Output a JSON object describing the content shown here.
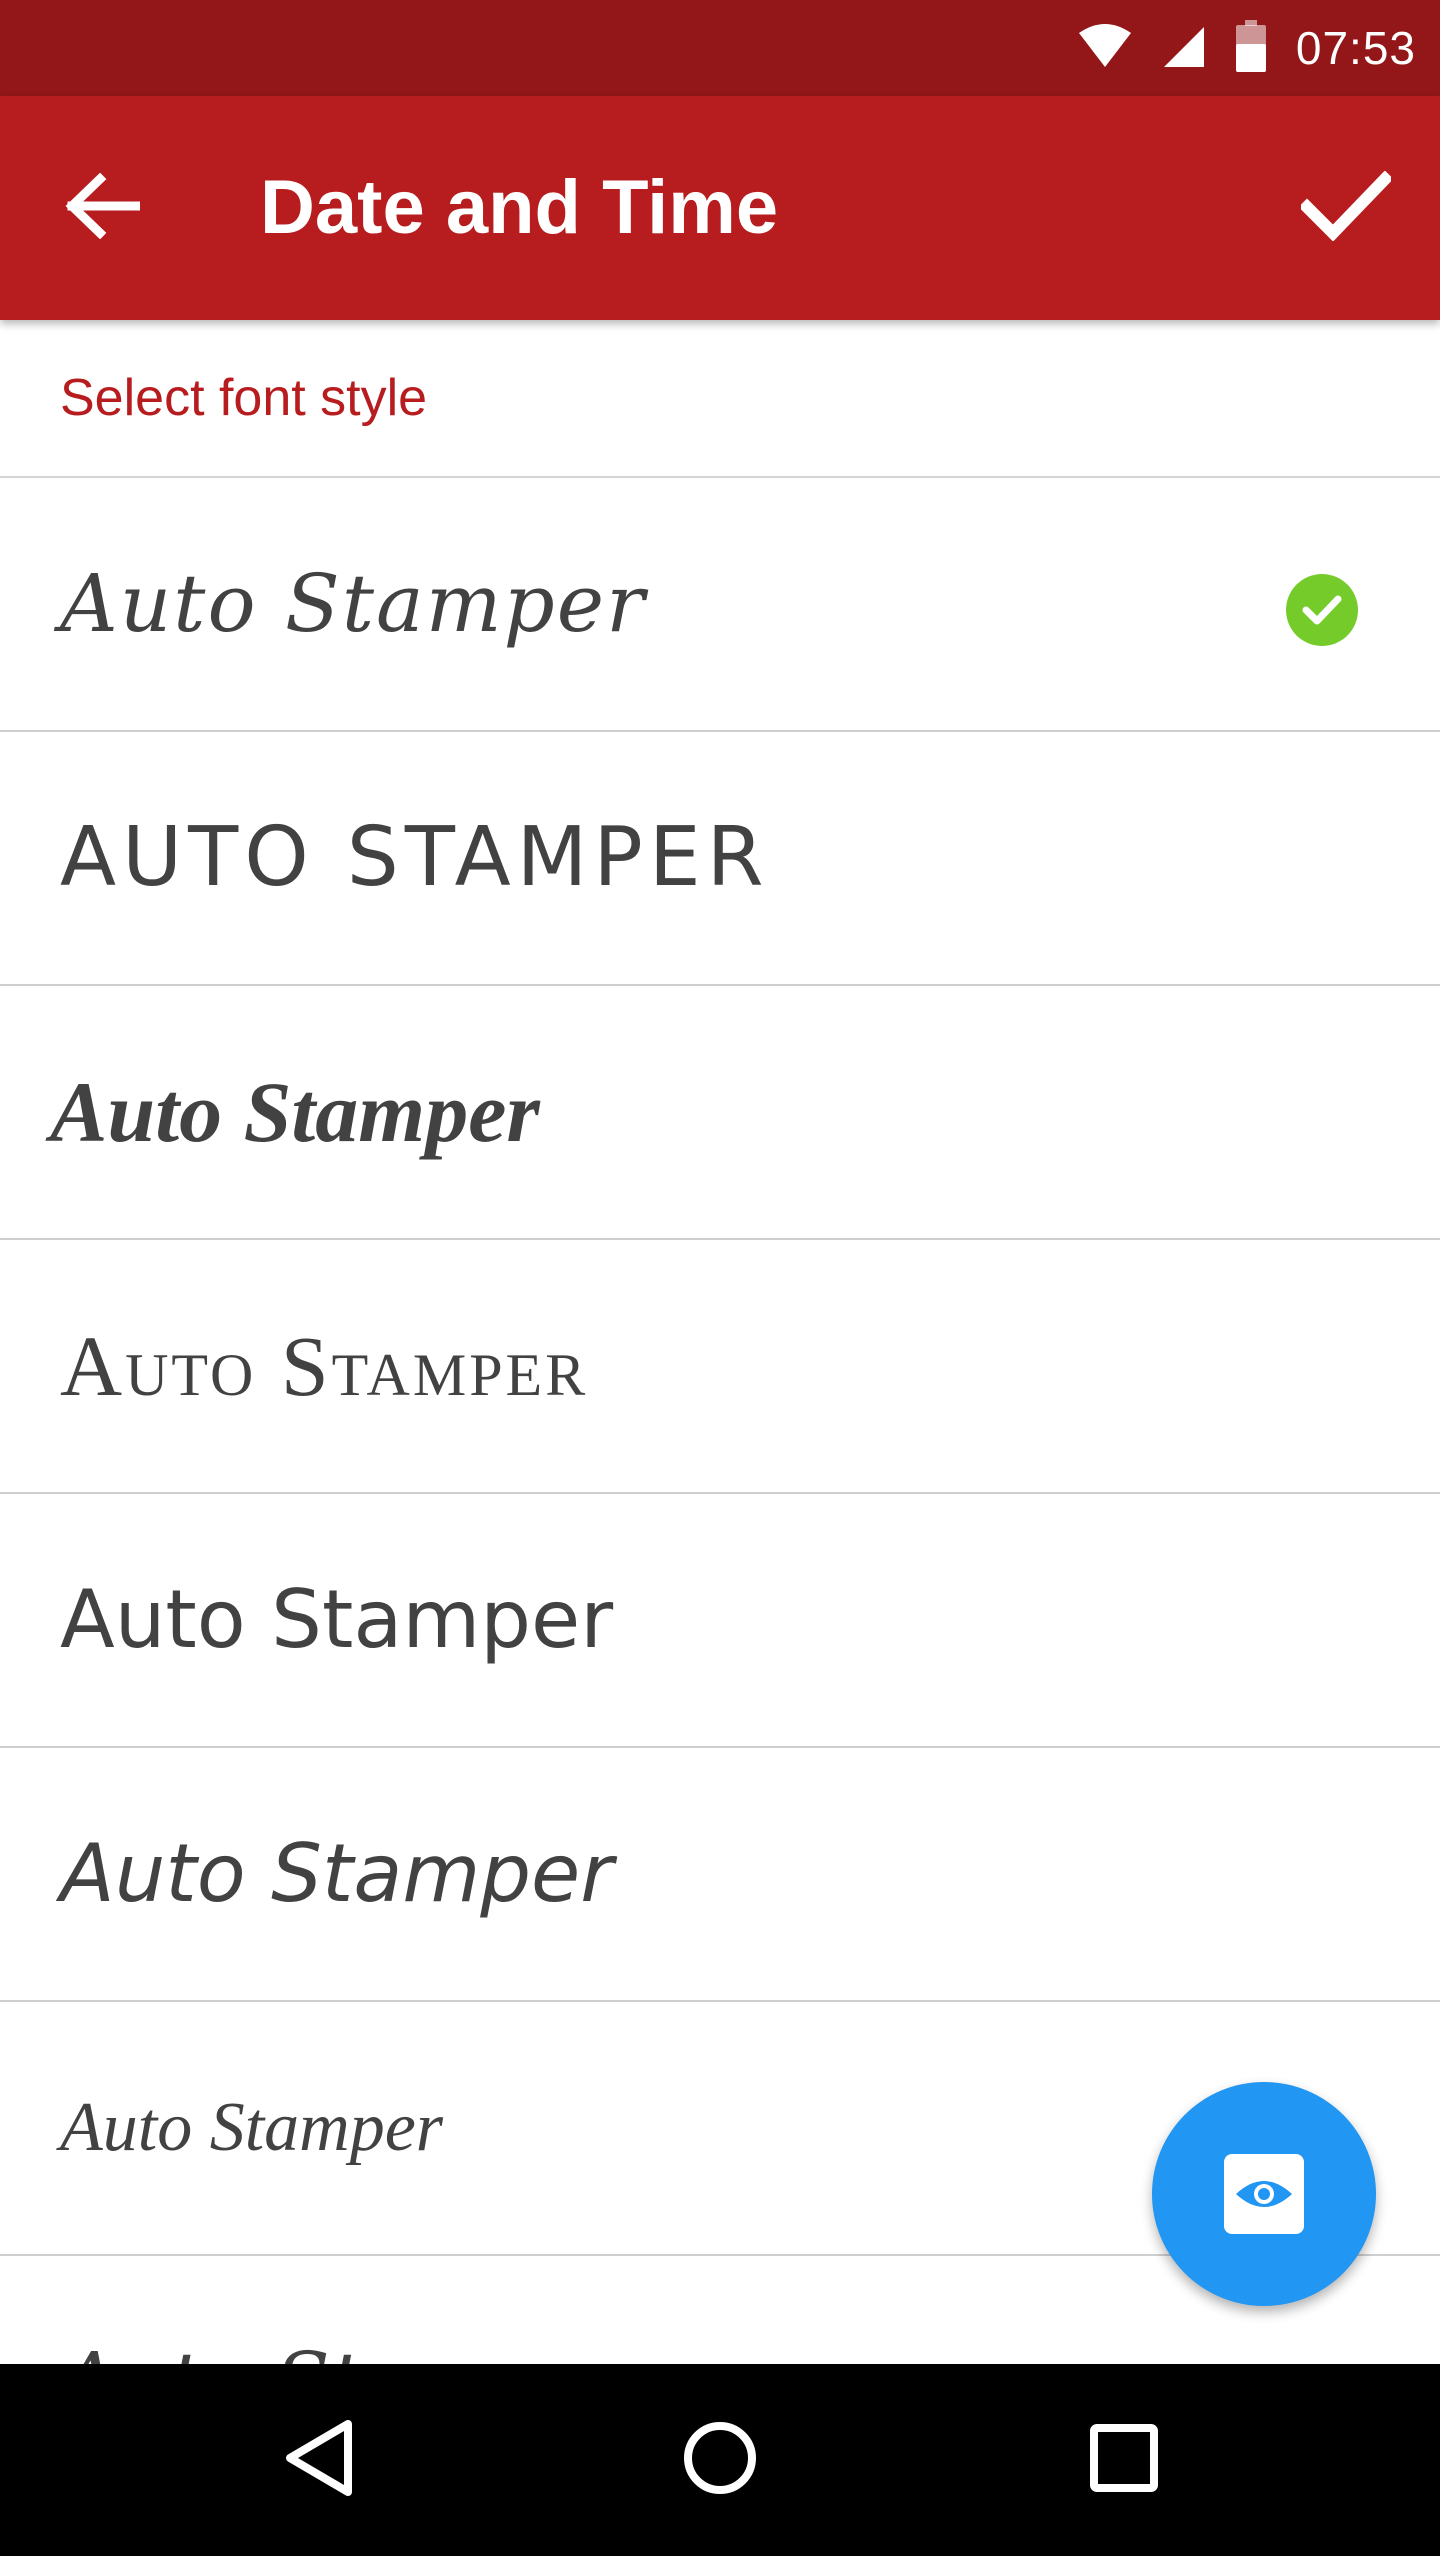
{
  "status_bar": {
    "time": "07:53",
    "icons": [
      "wifi-icon",
      "cell-signal-icon",
      "battery-icon"
    ]
  },
  "app_bar": {
    "title": "Date and Time",
    "back_icon": "arrow-left-icon",
    "confirm_icon": "check-icon",
    "background_color": "#b71c1f"
  },
  "section": {
    "label": "Select font style",
    "color": "#b71c1f"
  },
  "font_options": [
    {
      "label": "Auto Stamper",
      "selected": true
    },
    {
      "label": "AUTO STAMPER",
      "selected": false
    },
    {
      "label": "Auto Stamper",
      "selected": false
    },
    {
      "label": "Auto Stamper",
      "selected": false
    },
    {
      "label": "Auto Stamper",
      "selected": false
    },
    {
      "label": "Auto Stamper",
      "selected": false
    },
    {
      "label": "Auto Stamper",
      "selected": false
    },
    {
      "label": "Auto Stamper",
      "selected": false
    }
  ],
  "selected_badge_color": "#74cb2a",
  "fab": {
    "icon": "eye-icon",
    "color": "#2196f3"
  },
  "nav_bar": {
    "icons": [
      "back-triangle-icon",
      "home-circle-icon",
      "recents-square-icon"
    ]
  }
}
